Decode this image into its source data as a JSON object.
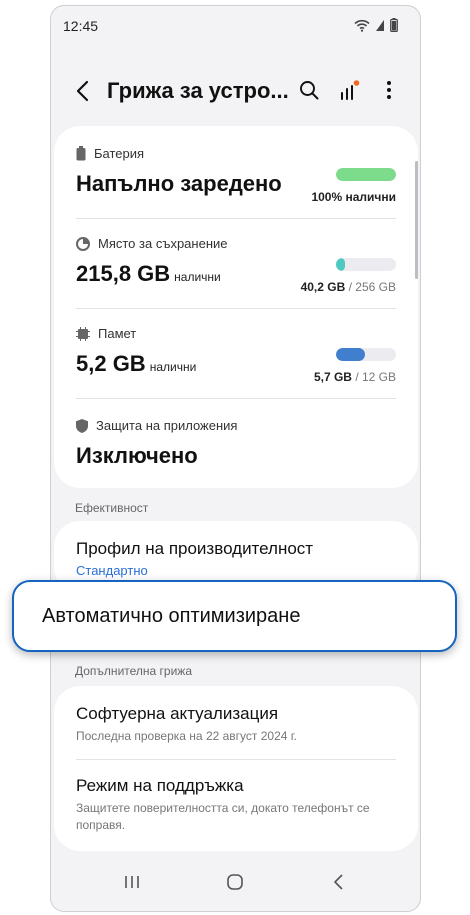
{
  "status_bar": {
    "time": "12:45"
  },
  "app_bar": {
    "title": "Грижа за устро..."
  },
  "battery": {
    "label": "Батерия",
    "value": "Напълно заредено",
    "percent_text": "100% налични",
    "fill_fraction": 1.0,
    "color": "#7ddc8b"
  },
  "storage": {
    "label": "Място за съхранение",
    "value": "215,8 GB",
    "value_suffix": "налични",
    "used": "40,2 GB",
    "total": "/ 256 GB",
    "fill_fraction": 0.157,
    "color": "#4fc8c1"
  },
  "memory": {
    "label": "Памет",
    "value": "5,2 GB",
    "value_suffix": "налични",
    "used": "5,7 GB",
    "total": "/ 12 GB",
    "fill_fraction": 0.475,
    "color": "#3f7fce"
  },
  "app_protection": {
    "label": "Защита на приложения",
    "value": "Изключено"
  },
  "efficiency": {
    "section_label": "Ефективност",
    "performance_title": "Профил на производителност",
    "performance_value": "Стандартно",
    "auto_optimize": "Автоматично оптимизиране"
  },
  "additional_care": {
    "section_label": "Допълнителна грижа",
    "software_update_title": "Софтуерна актуализация",
    "software_update_sub": "Последна проверка на 22 август 2024 г.",
    "maintenance_title": "Режим на поддръжка",
    "maintenance_sub": "Защитете поверителността си, докато телефонът се поправя."
  },
  "colors": {
    "accent": "#1565c0",
    "link": "#2a6fd6",
    "notification_dot": "#f26a21"
  },
  "icons": [
    "wifi-icon",
    "signal-icon",
    "battery-status-icon",
    "back-arrow-icon",
    "search-icon",
    "diagnostics-icon",
    "more-icon",
    "battery-icon",
    "storage-icon",
    "memory-icon",
    "shield-icon",
    "recent-apps-icon",
    "home-icon",
    "back-nav-icon"
  ]
}
